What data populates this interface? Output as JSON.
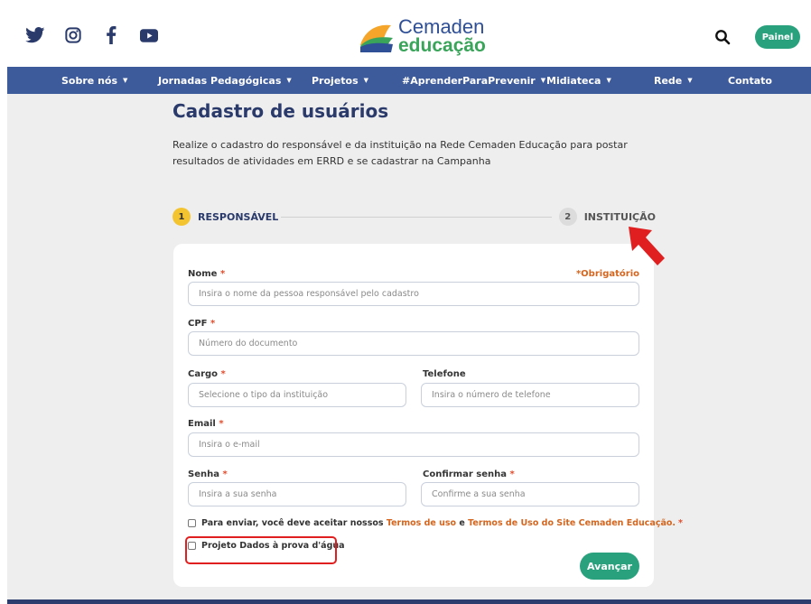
{
  "header": {
    "social_icons": [
      "twitter-icon",
      "instagram-icon",
      "facebook-icon",
      "youtube-icon"
    ],
    "logo_line1": "Cemaden",
    "logo_line2": "educação",
    "painel_label": "Painel"
  },
  "nav": {
    "items": [
      {
        "label": "Sobre nós",
        "caret": "▼"
      },
      {
        "label": "Jornadas Pedagógicas",
        "caret": "▼"
      },
      {
        "label": "Projetos",
        "caret": "▼"
      },
      {
        "label": "#AprenderParaPrevenir",
        "caret": "▼"
      },
      {
        "label": "Midiateca",
        "caret": "▼"
      },
      {
        "label": "Rede",
        "caret": "▼"
      },
      {
        "label": "Contato"
      }
    ]
  },
  "page": {
    "title": "Cadastro de usuários",
    "description": "Realize o cadastro do responsável e da instituição na Rede Cemaden Educação para postar resultados de atividades em ERRD e se cadastrar na Campanha"
  },
  "steps": [
    {
      "number": "1",
      "label": "RESPONSÁVEL"
    },
    {
      "number": "2",
      "label": "INSTITUIÇÃO"
    }
  ],
  "form": {
    "required_note": "*Obrigatório",
    "required_mark": "*",
    "nome": {
      "label": "Nome",
      "placeholder": "Insira o nome da pessoa responsável pelo cadastro"
    },
    "cpf": {
      "label": "CPF",
      "placeholder": "Número do documento"
    },
    "cargo": {
      "label": "Cargo",
      "placeholder": "Selecione o tipo da instituição"
    },
    "telefone": {
      "label": "Telefone",
      "placeholder": "Insira o número de telefone"
    },
    "email": {
      "label": "Email",
      "placeholder": "Insira o e-mail"
    },
    "senha": {
      "label": "Senha",
      "placeholder": "Insira a sua senha"
    },
    "confirmar": {
      "label": "Confirmar senha",
      "placeholder": "Confirme a sua senha"
    },
    "terms_prefix": "Para enviar, você deve aceitar nossos",
    "terms_link1": "Termos de uso",
    "terms_and": "e",
    "terms_link2": "Termos de Uso do Site Cemaden Educação.",
    "project_label": "Projeto Dados à prova d'água",
    "submit_label": "Avançar"
  },
  "colors": {
    "nav_bg": "#3d5a9b",
    "brand_green": "#2aa17d",
    "link_orange": "#d4661f",
    "active_step": "#f4c430",
    "annotation_red": "#e02020"
  }
}
